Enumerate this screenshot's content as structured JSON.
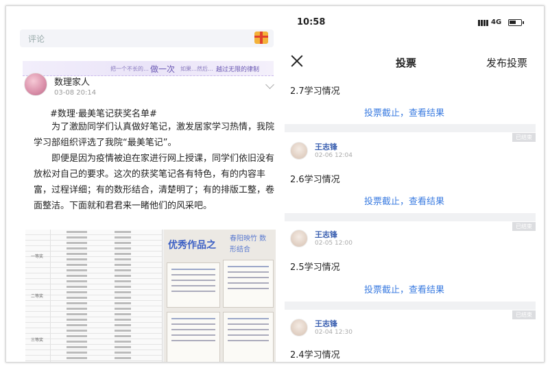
{
  "left": {
    "comment_placeholder": "评论",
    "banner": {
      "t1": "把一个不长的…",
      "t2": "做一次",
      "t3": "如果…然后…",
      "t4": "越过无限的律制"
    },
    "author": "数理家人",
    "date": "03-08 20:14",
    "post_title": "#数理·最美笔记获奖名单#",
    "paragraphs": [
      "为了激励同学们认真做好笔记，激发居家学习热情，我院学习部组织评选了我院“最美笔记”。",
      "即便是因为疫情被迫在家进行网上授课，同学们依旧没有放松对自己的要求。这次的获奖笔记各有特色，有的内容丰富，过程详细；有的数形结合，清楚明了；有的排版工整，卷面整洁。下面就和君君来一睹他们的风采吧。"
    ],
    "photo": {
      "title": "优秀作品之",
      "calligraphy": "春阳映竹 数形结合",
      "row_labels": [
        "一等奖",
        "二等奖",
        "三等奖"
      ]
    }
  },
  "right": {
    "status": {
      "time": "10:58",
      "network": "4G"
    },
    "nav": {
      "title": "投票",
      "action": "发布投票"
    },
    "top_item_title": "2.7学习情况",
    "link_text": "投票截止，查看结果",
    "badge_text": "已结束",
    "cards": [
      {
        "user": "王志锋",
        "date": "02-06 12:04",
        "title": "2.6学习情况"
      },
      {
        "user": "王志锋",
        "date": "02-05 12:00",
        "title": "2.5学习情况"
      },
      {
        "user": "王志锋",
        "date": "02-04 12:30",
        "title": "2.4学习情况"
      }
    ]
  }
}
